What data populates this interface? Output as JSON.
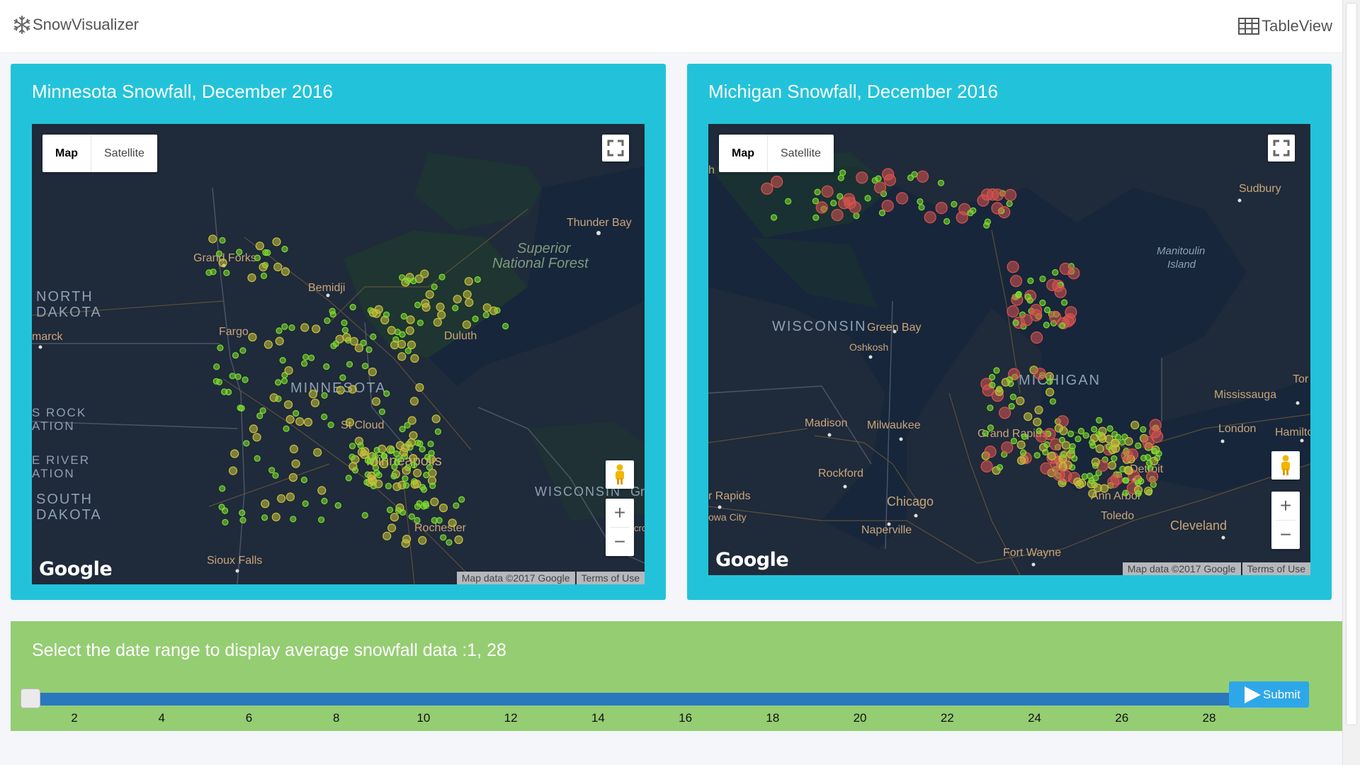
{
  "navbar": {
    "brand": "SnowVisualizer",
    "brand_icon": "snowflake-icon",
    "table_view": "TableView",
    "table_icon": "table-icon"
  },
  "panels": [
    {
      "title": "Minnesota Snowfall, December 2016",
      "map": {
        "map_label": "Map",
        "satellite_label": "Satellite",
        "attribution": "Map data ©2017 Google",
        "terms": "Terms of Use",
        "logo": "Google",
        "places": [
          "Thunder Bay",
          "Superior",
          "National Forest",
          "Grand Forks",
          "NORTH",
          "DAKOTA",
          "Bemidji",
          "marck",
          "Fargo",
          "Duluth",
          "MINNESOTA",
          "S ROCK",
          "ATION",
          "St Cloud",
          "Minneapolis",
          "E RIVER",
          "ATION",
          "SOUTH",
          "DAKOTA",
          "WISCONSIN",
          "Gre",
          "Rochester",
          "cros",
          "Sioux Falls"
        ]
      }
    },
    {
      "title": "Michigan Snowfall, December 2016",
      "map": {
        "map_label": "Map",
        "satellite_label": "Satellite",
        "attribution": "Map data ©2017 Google",
        "terms": "Terms of Use",
        "logo": "Google",
        "places": [
          "h",
          "Sudbury",
          "Manitoulin",
          "Island",
          "WISCONSIN",
          "Green Bay",
          "Oshkosh",
          "MICHIGAN",
          "Tor",
          "Mississauga",
          "Madison",
          "Milwaukee",
          "Grand Rapids",
          "London",
          "Hamilto",
          "Detroit",
          "Rockford",
          "r Rapids",
          "Chicago",
          "Ann Arbor",
          "Toledo",
          "owa City",
          "Naperville",
          "Cleveland",
          "Fort Wayne"
        ]
      }
    }
  ],
  "slider": {
    "label": "Select the date range to display average snowfall data :1, 28",
    "range": [
      1,
      28
    ],
    "min": 1,
    "max": 29,
    "ticks": [
      "2",
      "4",
      "6",
      "8",
      "10",
      "12",
      "14",
      "16",
      "18",
      "20",
      "22",
      "24",
      "26",
      "28"
    ],
    "submit": "Submit"
  },
  "colors": {
    "panel": "#22c3da",
    "slider_panel": "#95cd73",
    "track": "#2978bd",
    "submit": "#2ea7e8",
    "map_bg": "#1b2636",
    "low": "#7ddc2e",
    "mid": "#c7c13a",
    "high": "#d9534f"
  }
}
